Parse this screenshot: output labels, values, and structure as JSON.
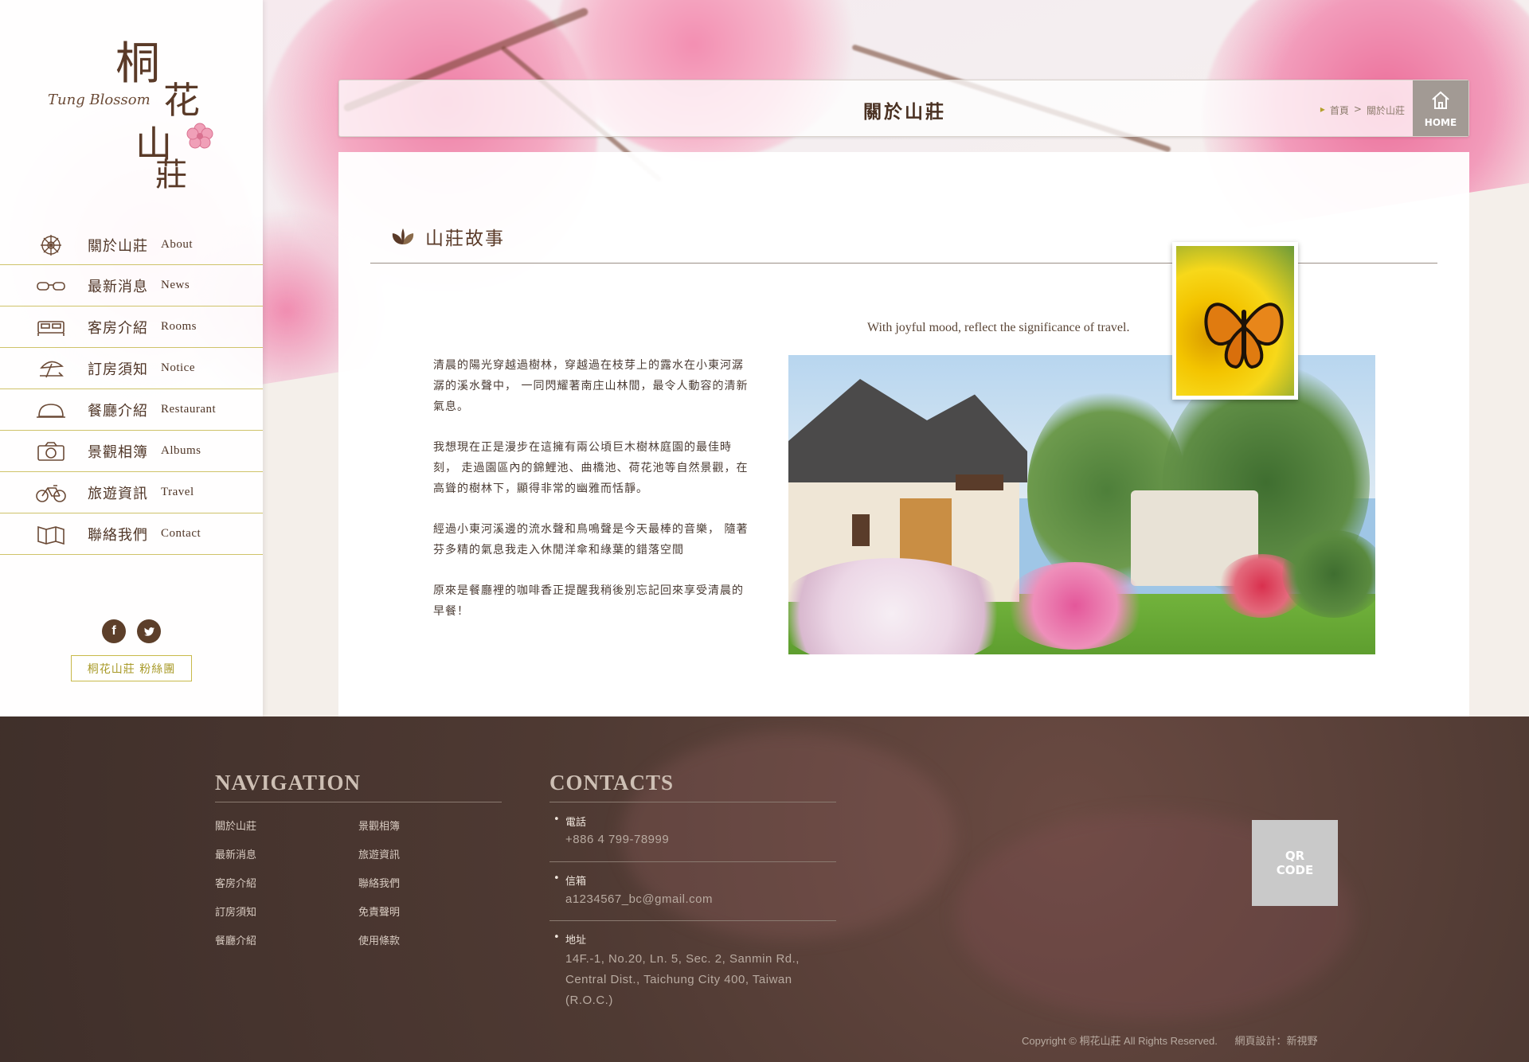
{
  "brand": {
    "name_en": "Tung Blossom",
    "name_cn_chars": [
      "桐",
      "花",
      "山",
      "莊"
    ]
  },
  "sidebar": {
    "items": [
      {
        "cn": "關於山莊",
        "en": "About",
        "icon": "dharma-wheel-icon"
      },
      {
        "cn": "最新消息",
        "en": "News",
        "icon": "glasses-icon"
      },
      {
        "cn": "客房介紹",
        "en": "Rooms",
        "icon": "bed-icon"
      },
      {
        "cn": "訂房須知",
        "en": "Notice",
        "icon": "beach-umbrella-icon"
      },
      {
        "cn": "餐廳介紹",
        "en": "Restaurant",
        "icon": "cloche-icon"
      },
      {
        "cn": "景觀相簿",
        "en": "Albums",
        "icon": "camera-icon"
      },
      {
        "cn": "旅遊資訊",
        "en": "Travel",
        "icon": "bicycle-icon"
      },
      {
        "cn": "聯絡我們",
        "en": "Contact",
        "icon": "map-icon"
      }
    ],
    "social": {
      "facebook": "f",
      "twitter": "t"
    },
    "fan_page_label": "桐花山莊 粉絲團"
  },
  "header": {
    "title": "關於山莊",
    "breadcrumb": {
      "home": "首頁",
      "separator": ">",
      "current": "關於山莊"
    },
    "home_button": "HOME"
  },
  "content": {
    "section_title": "山莊故事",
    "tagline": "With joyful mood, reflect the significance of travel.",
    "paragraphs": [
      "清晨的陽光穿越過樹林，穿越過在枝芽上的露水在小東河潺潺的溪水聲中， 一同閃耀著南庄山林間，最令人動容的清新氣息。",
      "我想現在正是漫步在這擁有兩公頃巨木樹林庭園的最佳時刻， 走過園區內的錦鯉池、曲橋池、荷花池等自然景觀，在高聳的樹林下，顯得非常的幽雅而恬靜。",
      "經過小東河溪邊的流水聲和鳥鳴聲是今天最棒的音樂， 隨著芬多精的氣息我走入休閒洋傘和綠葉的錯落空間",
      "原來是餐廳裡的咖啡香正提醒我稍後別忘記回來享受清晨的早餐！"
    ]
  },
  "footer": {
    "navigation_heading": "NAVIGATION",
    "nav_col1": [
      "關於山莊",
      "最新消息",
      "客房介紹",
      "訂房須知",
      "餐廳介紹"
    ],
    "nav_col2": [
      "景觀相簿",
      "旅遊資訊",
      "聯絡我們",
      "免責聲明",
      "使用條款"
    ],
    "contacts_heading": "CONTACTS",
    "phone_label": "電話",
    "phone": "+886 4 799-78999",
    "email_label": "信箱",
    "email": "a1234567_bc@gmail.com",
    "address_label": "地址",
    "address_lines": [
      "14F.-1, No.20, Ln. 5, Sec. 2, Sanmin Rd.,",
      "Central Dist., Taichung City 400, Taiwan",
      "(R.O.C.)"
    ],
    "qr_lines": [
      "QR",
      "CODE"
    ],
    "copyright": "Copyright © 桐花山莊 All Rights Reserved.",
    "designer": "網頁設計：新視野"
  },
  "colors": {
    "brown": "#5a3a28",
    "gold_rule": "#cfc36a",
    "footer_bg": "#4f3a33",
    "home_btn": "#a29a94"
  }
}
